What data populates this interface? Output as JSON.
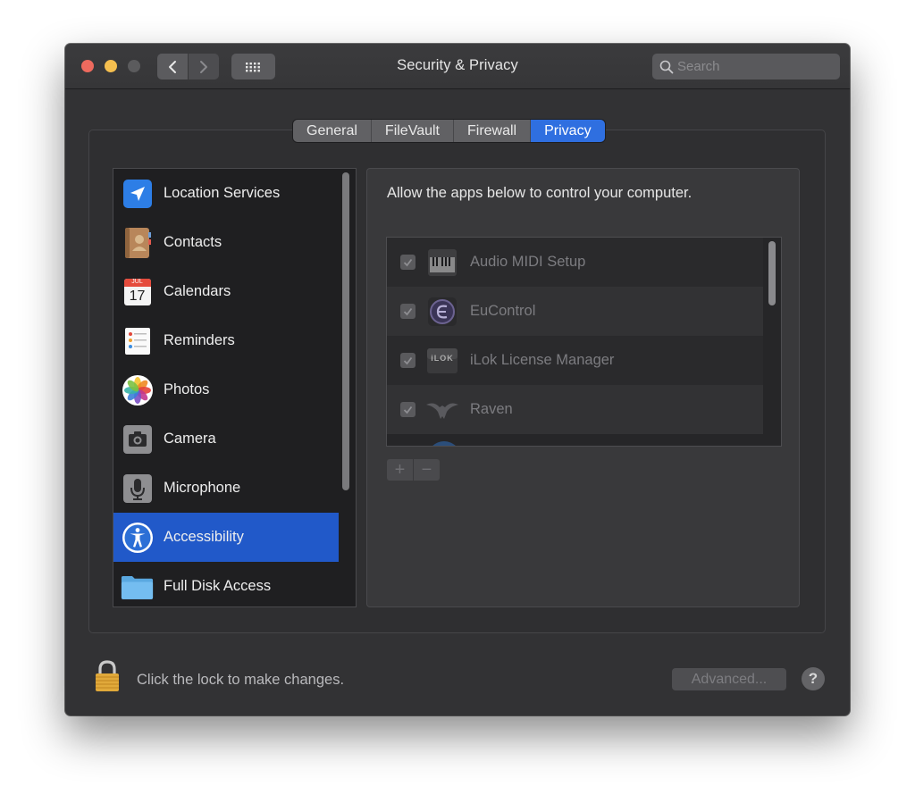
{
  "window": {
    "title": "Security & Privacy",
    "search_placeholder": "Search"
  },
  "tabs": [
    {
      "label": "General",
      "active": false
    },
    {
      "label": "FileVault",
      "active": false
    },
    {
      "label": "Firewall",
      "active": false
    },
    {
      "label": "Privacy",
      "active": true
    }
  ],
  "sidebar": {
    "items": [
      {
        "label": "Location Services",
        "icon": "location-arrow-icon",
        "selected": false
      },
      {
        "label": "Contacts",
        "icon": "contacts-book-icon",
        "selected": false
      },
      {
        "label": "Calendars",
        "icon": "calendar-icon",
        "selected": false
      },
      {
        "label": "Reminders",
        "icon": "reminders-list-icon",
        "selected": false
      },
      {
        "label": "Photos",
        "icon": "photos-flower-icon",
        "selected": false
      },
      {
        "label": "Camera",
        "icon": "camera-icon",
        "selected": false
      },
      {
        "label": "Microphone",
        "icon": "microphone-icon",
        "selected": false
      },
      {
        "label": "Accessibility",
        "icon": "accessibility-icon",
        "selected": true
      },
      {
        "label": "Full Disk Access",
        "icon": "folder-icon",
        "selected": false
      }
    ],
    "calendar_month": "JUL",
    "calendar_day": "17"
  },
  "panel": {
    "description": "Allow the apps below to control your computer.",
    "apps": [
      {
        "name": "Audio MIDI Setup",
        "checked": true,
        "icon": "piano-keys-icon"
      },
      {
        "name": "EuControl",
        "checked": true,
        "icon": "eucontrol-icon"
      },
      {
        "name": "iLok License Manager",
        "checked": true,
        "icon": "ilok-icon"
      },
      {
        "name": "Raven",
        "checked": true,
        "icon": "raven-bird-icon"
      }
    ],
    "ilok_logo_text": "iLOK",
    "add_label": "+",
    "remove_label": "−"
  },
  "footer": {
    "lock_text": "Click the lock to make changes.",
    "advanced_label": "Advanced...",
    "help_label": "?"
  },
  "colors": {
    "accent": "#2f6fe0",
    "selection": "#2159c9",
    "close": "#ed6a5e",
    "minimize": "#f5bf4f"
  }
}
